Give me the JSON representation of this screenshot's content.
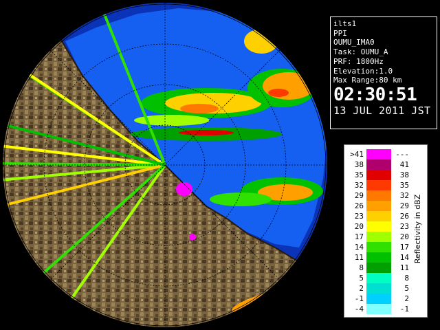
{
  "info": {
    "site": "ilts1",
    "mode": "PPI",
    "product": "OUMU_IMA0",
    "task": "Task: OUMU_A",
    "prf": "PRF: 1800Hz",
    "elevation": "Elevation:1.0",
    "max_range": "Max Range:80 km",
    "time": "02:30:51",
    "date": "13 JUL 2011 JST"
  },
  "legend": {
    "axis_label": "Reflectivity in dBZ",
    "rows": [
      {
        "left": ">41",
        "right": "---",
        "color": "#ff00ff"
      },
      {
        "left": "38",
        "right": "41",
        "color": "#b0006e"
      },
      {
        "left": "35",
        "right": "38",
        "color": "#e00000"
      },
      {
        "left": "32",
        "right": "35",
        "color": "#ff3a00"
      },
      {
        "left": "29",
        "right": "32",
        "color": "#ff7800"
      },
      {
        "left": "26",
        "right": "29",
        "color": "#ffa000"
      },
      {
        "left": "23",
        "right": "26",
        "color": "#ffd000"
      },
      {
        "left": "20",
        "right": "23",
        "color": "#ffff00"
      },
      {
        "left": "17",
        "right": "20",
        "color": "#a0ff00"
      },
      {
        "left": "14",
        "right": "17",
        "color": "#30e000"
      },
      {
        "left": "11",
        "right": "14",
        "color": "#00c000"
      },
      {
        "left": "8",
        "right": "11",
        "color": "#00a000"
      },
      {
        "left": "5",
        "right": "8",
        "color": "#00ffc0"
      },
      {
        "left": "2",
        "right": "5",
        "color": "#00e0d0"
      },
      {
        "left": "-1",
        "right": "2",
        "color": "#00d0ff"
      },
      {
        "left": "-4",
        "right": "-1",
        "color": "#80ffff"
      }
    ]
  },
  "colors": {
    "sea": "#1560f0",
    "outer_sea": "#0b33b8",
    "land": "#7a6440",
    "land_dark": "#3d2c18",
    "rings": "#000000"
  }
}
